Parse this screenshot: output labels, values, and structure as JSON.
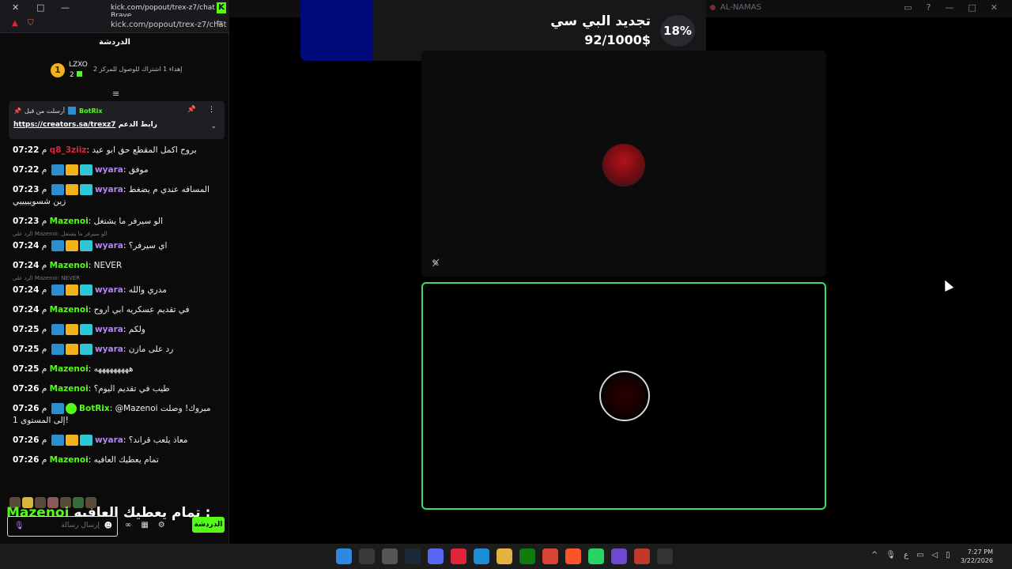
{
  "browser": {
    "title": "kick.com/popout/trex-z7/chat - Brave",
    "url": "kick.com/popout/trex-z7/chat"
  },
  "main_window": {
    "title": "AL-NAMAS",
    "goal": {
      "title": "تجديد البي سي",
      "amount": "92/1000$",
      "percent": "18%",
      "progress": 0.18
    }
  },
  "chat": {
    "header": "الدردشة",
    "leaderboard": {
      "rank": "1",
      "name": "LZXO",
      "score": "2",
      "gift_text": "إهداء 1 اشتراك للوصول للمركز 2"
    },
    "pinned": {
      "by_label": "أرسلت من قبل",
      "by_user": "BotRix",
      "link_label": "رابط الدعم",
      "link_url": "https://creators.sa/trexz7"
    },
    "messages": [
      {
        "time": "07:22",
        "user": "q8_3ziiz",
        "color": "#e0243a",
        "badges": [],
        "text": "بروح اكمل المقطع حق ابو عيد"
      },
      {
        "time": "07:22",
        "user": "wyara",
        "color": "#b685f3",
        "badges": [
          "hammer",
          "crown",
          "og"
        ],
        "text": "موفق"
      },
      {
        "time": "07:23",
        "user": "wyara",
        "color": "#b685f3",
        "badges": [
          "hammer",
          "crown",
          "og"
        ],
        "text": "المسافه عندي م يضغط زين شسويييييي"
      },
      {
        "time": "07:23",
        "user": "Mazenoi",
        "color": "#53fc18",
        "badges": [],
        "text": "الو سيرفر ما يشتغل"
      },
      {
        "reply": "الرد على Mazenoi: الو سيرفر ما يشتغل",
        "time": "07:24",
        "user": "wyara",
        "color": "#b685f3",
        "badges": [
          "hammer",
          "crown",
          "og"
        ],
        "text": "اي سيرفر؟"
      },
      {
        "time": "07:24",
        "user": "Mazenoi",
        "color": "#53fc18",
        "badges": [],
        "text": "NEVER"
      },
      {
        "reply": "الرد على Mazenoi: NEVER",
        "time": "07:24",
        "user": "wyara",
        "color": "#b685f3",
        "badges": [
          "hammer",
          "crown",
          "og"
        ],
        "text": "مدري والله"
      },
      {
        "time": "07:24",
        "user": "Mazenoi",
        "color": "#53fc18",
        "badges": [],
        "text": "في تقديم عسكريه ابي اروح"
      },
      {
        "time": "07:25",
        "user": "wyara",
        "color": "#b685f3",
        "badges": [
          "hammer",
          "crown",
          "og"
        ],
        "text": "ولكم"
      },
      {
        "time": "07:25",
        "user": "wyara",
        "color": "#b685f3",
        "badges": [
          "hammer",
          "crown",
          "og"
        ],
        "text": "رد على مازن"
      },
      {
        "time": "07:25",
        "user": "Mazenoi",
        "color": "#53fc18",
        "badges": [],
        "text": "هههههههههه"
      },
      {
        "time": "07:26",
        "user": "Mazenoi",
        "color": "#53fc18",
        "badges": [],
        "text": "طيب في تقديم اليوم؟"
      },
      {
        "time": "07:26",
        "user": "BotRix",
        "color": "#53fc18",
        "badges": [
          "hammer",
          "verified"
        ],
        "text": "@Mazenoi مبروك! وصلت إلى المستوى 1!"
      },
      {
        "time": "07:26",
        "user": "wyara",
        "color": "#b685f3",
        "badges": [
          "hammer",
          "crown",
          "og"
        ],
        "text": "معاذ يلعب قراند؟"
      },
      {
        "time": "07:26",
        "user": "Mazenoi",
        "color": "#53fc18",
        "badges": [],
        "text": "تمام يعطيك العافيه"
      }
    ],
    "overlay": {
      "user": "Mazenoi",
      "text": "تمام يعطيك العافيه :"
    },
    "input": {
      "placeholder": "إرسال رسالة"
    },
    "send_label": "الدردشة"
  },
  "taskbar": {
    "time": "7:27 PM",
    "date": "3/22/2026",
    "language": "ع"
  },
  "colors": {
    "kick_green": "#53fc18",
    "goal_fill": "#000a7a",
    "speaking_border": "#3fdc6b"
  }
}
